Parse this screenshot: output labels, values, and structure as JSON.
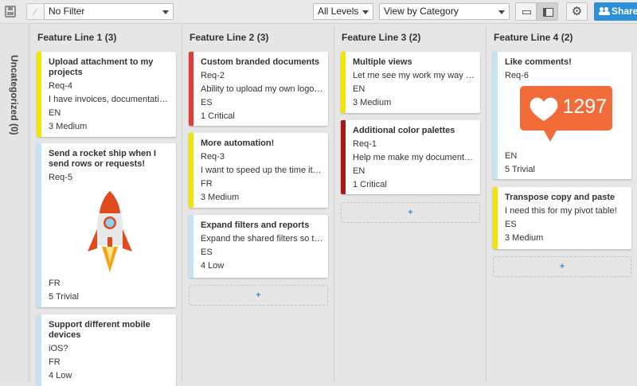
{
  "toolbar": {
    "filter_value": "No Filter",
    "levels_value": "All Levels",
    "view_value": "View by Category",
    "share_label": "Share"
  },
  "icons": {
    "save": "save-icon",
    "filter": "filter-icon",
    "compact_view": "compact-view-icon",
    "full_view": "card-view-icon",
    "settings": "gear-icon",
    "share": "people-icon"
  },
  "colors": {
    "accent": "#2d8fd6",
    "stripe_medium": "#f2e600",
    "stripe_critical": "#e53935",
    "stripe_critical_dark": "#a91b1b",
    "stripe_low": "#c6e2f5",
    "badge": "#f26c3a"
  },
  "uncategorized": {
    "label": "Uncategorized (0)"
  },
  "columns": [
    {
      "title": "Feature Line 1 (3)",
      "cards": [
        {
          "title": "Upload attachment to my projects",
          "id": "Req-4",
          "desc": "I have invoices, documentations and",
          "lang": "EN",
          "priority": "3 Medium"
        },
        {
          "title": "Send a rocket ship when I send rows or requests!",
          "id": "Req-5",
          "image": "rocket",
          "lang": "FR",
          "priority": "5 Trivial"
        },
        {
          "title": "Support different mobile devices",
          "desc": "iOS?",
          "lang": "FR",
          "priority": "4 Low"
        }
      ]
    },
    {
      "title": "Feature Line 2 (3)",
      "cards": [
        {
          "title": "Custom branded documents",
          "id": "Req-2",
          "desc": "Ability to upload my own logo and",
          "lang": "ES",
          "priority": "1 Critical"
        },
        {
          "title": "More automation!",
          "id": "Req-3",
          "desc": "I want to speed up the time it takes",
          "lang": "FR",
          "priority": "3 Medium"
        },
        {
          "title": "Expand filters and reports",
          "desc": "Expand the shared filters so that it",
          "lang": "ES",
          "priority": "4 Low"
        }
      ],
      "add_label": "+"
    },
    {
      "title": "Feature Line 3 (2)",
      "cards": [
        {
          "title": "Multiple views",
          "desc": "Let me see my work my way and",
          "lang": "EN",
          "priority": "3 Medium"
        },
        {
          "title": "Additional color palettes",
          "id": "Req-1",
          "desc": "Help me make my documents look",
          "lang": "EN",
          "priority": "1 Critical"
        }
      ],
      "add_label": "+"
    },
    {
      "title": "Feature Line 4 (2)",
      "cards": [
        {
          "title": "Like comments!",
          "id": "Req-6",
          "image": "heart-badge",
          "badge_count": "1297",
          "lang": "EN",
          "priority": "5 Trivial"
        },
        {
          "title": "Transpose copy and paste",
          "desc": "I need this for my pivot table!",
          "lang": "ES",
          "priority": "3 Medium"
        }
      ],
      "add_label": "+"
    }
  ]
}
